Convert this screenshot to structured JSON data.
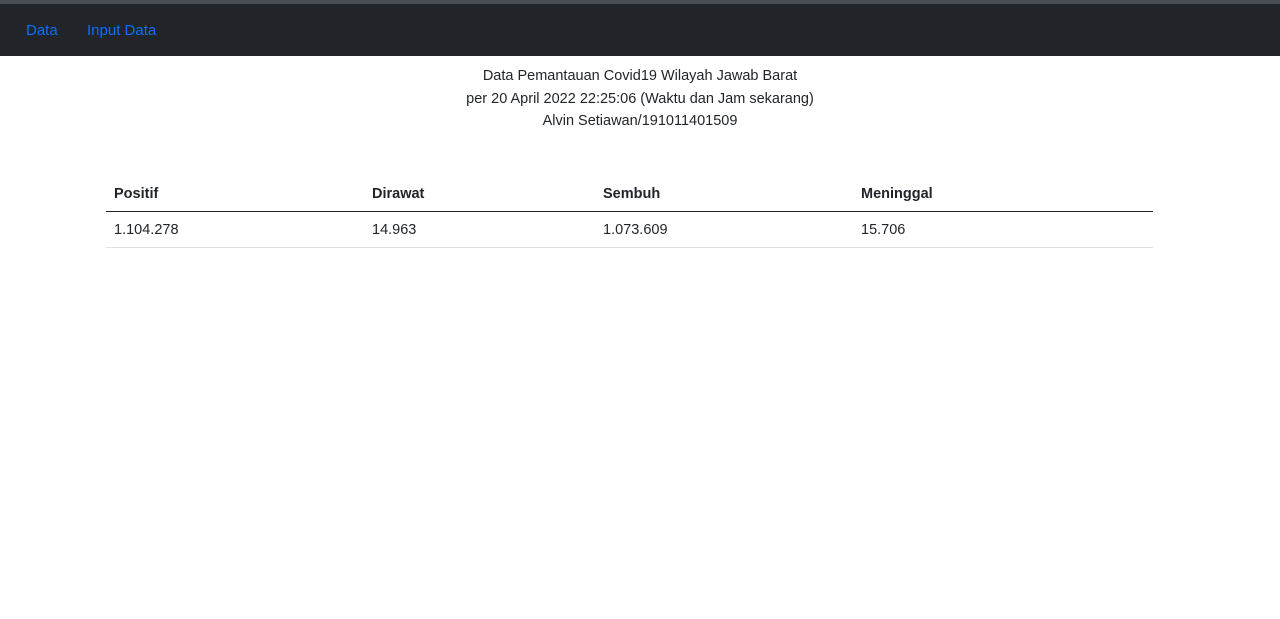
{
  "nav": {
    "items": [
      {
        "label": "Data"
      },
      {
        "label": "Input Data"
      }
    ],
    "link_color": "#0d6efd",
    "background": "#212529"
  },
  "header": {
    "title": "Data Pemantauan Covid19 Wilayah Jawab Barat",
    "date_line": "per 20 April 2022 22:25:06 (Waktu dan Jam sekarang)",
    "author": "Alvin Setiawan/191011401509"
  },
  "table": {
    "columns": [
      "Positif",
      "Dirawat",
      "Sembuh",
      "Meninggal"
    ],
    "rows": [
      [
        "1.104.278",
        "14.963",
        "1.073.609",
        "15.706"
      ]
    ]
  }
}
